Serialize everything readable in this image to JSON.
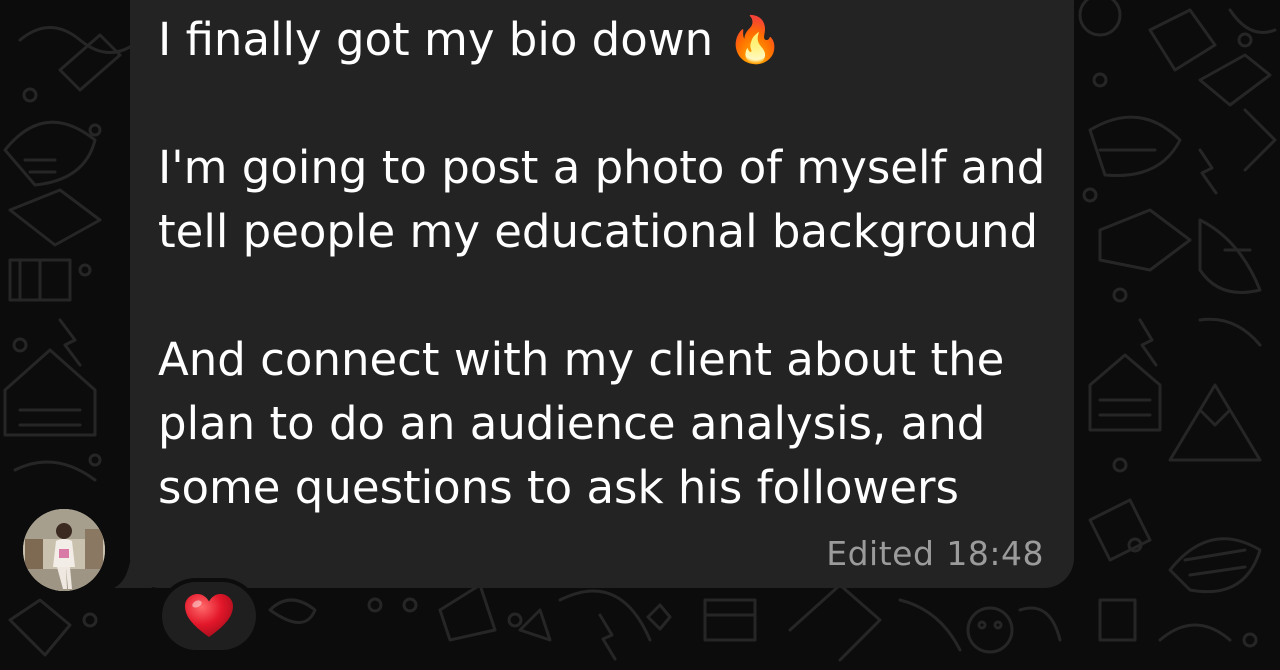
{
  "message": {
    "text": "I finally got my bio down 🔥\n\nI'm going to post a photo of myself and\ntell people my educational background\n\nAnd connect with my client about the\nplan to do an audience analysis, and\nsome questions to ask his followers",
    "edited_label": "Edited",
    "time": "18:48"
  },
  "reaction": {
    "emoji": "❤️",
    "icon": "red-heart-icon"
  },
  "sender": {
    "avatar_icon": "sender-profile-photo"
  },
  "colors": {
    "background": "#0c0c0c",
    "bubble": "#232323",
    "text": "#ffffff",
    "meta_text": "#9b9b9b",
    "heart": "#e3172a"
  }
}
